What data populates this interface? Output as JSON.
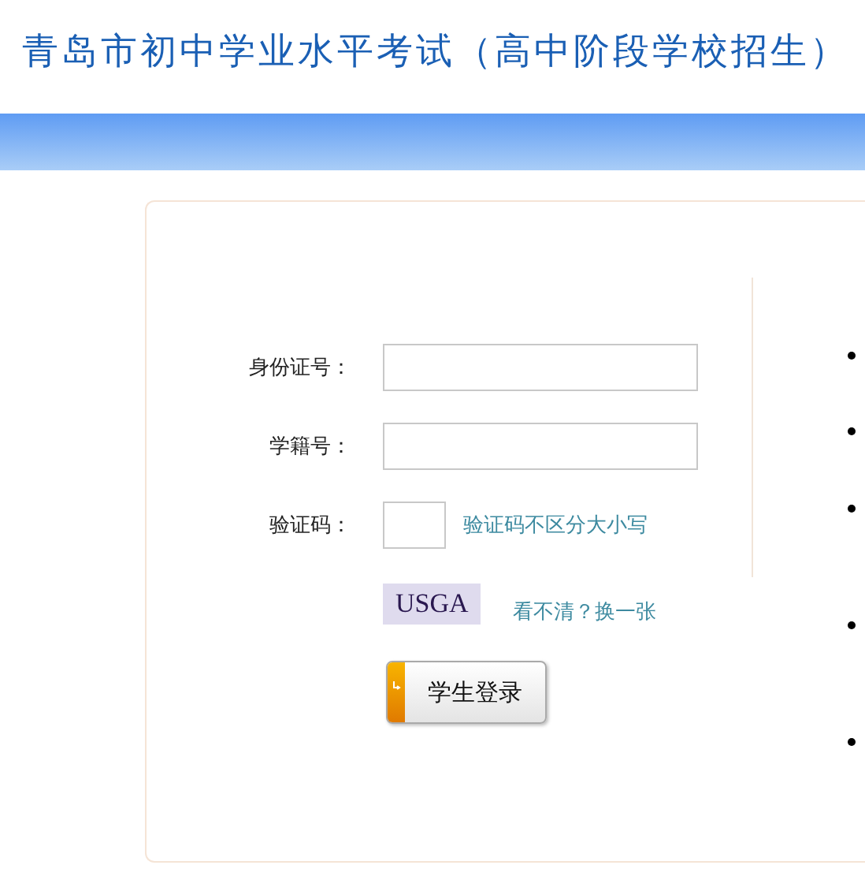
{
  "header": {
    "title": "青岛市初中学业水平考试（高中阶段学校招生）"
  },
  "form": {
    "fields": [
      {
        "label": "身份证号：",
        "kind": "text"
      },
      {
        "label": "学籍号：",
        "kind": "text"
      },
      {
        "label": "验证码：",
        "kind": "captcha",
        "hint": "验证码不区分大小写"
      }
    ],
    "captcha": {
      "code": "USGA",
      "refresh_link": "看不清？换一张"
    },
    "login_button": "学生登录"
  }
}
